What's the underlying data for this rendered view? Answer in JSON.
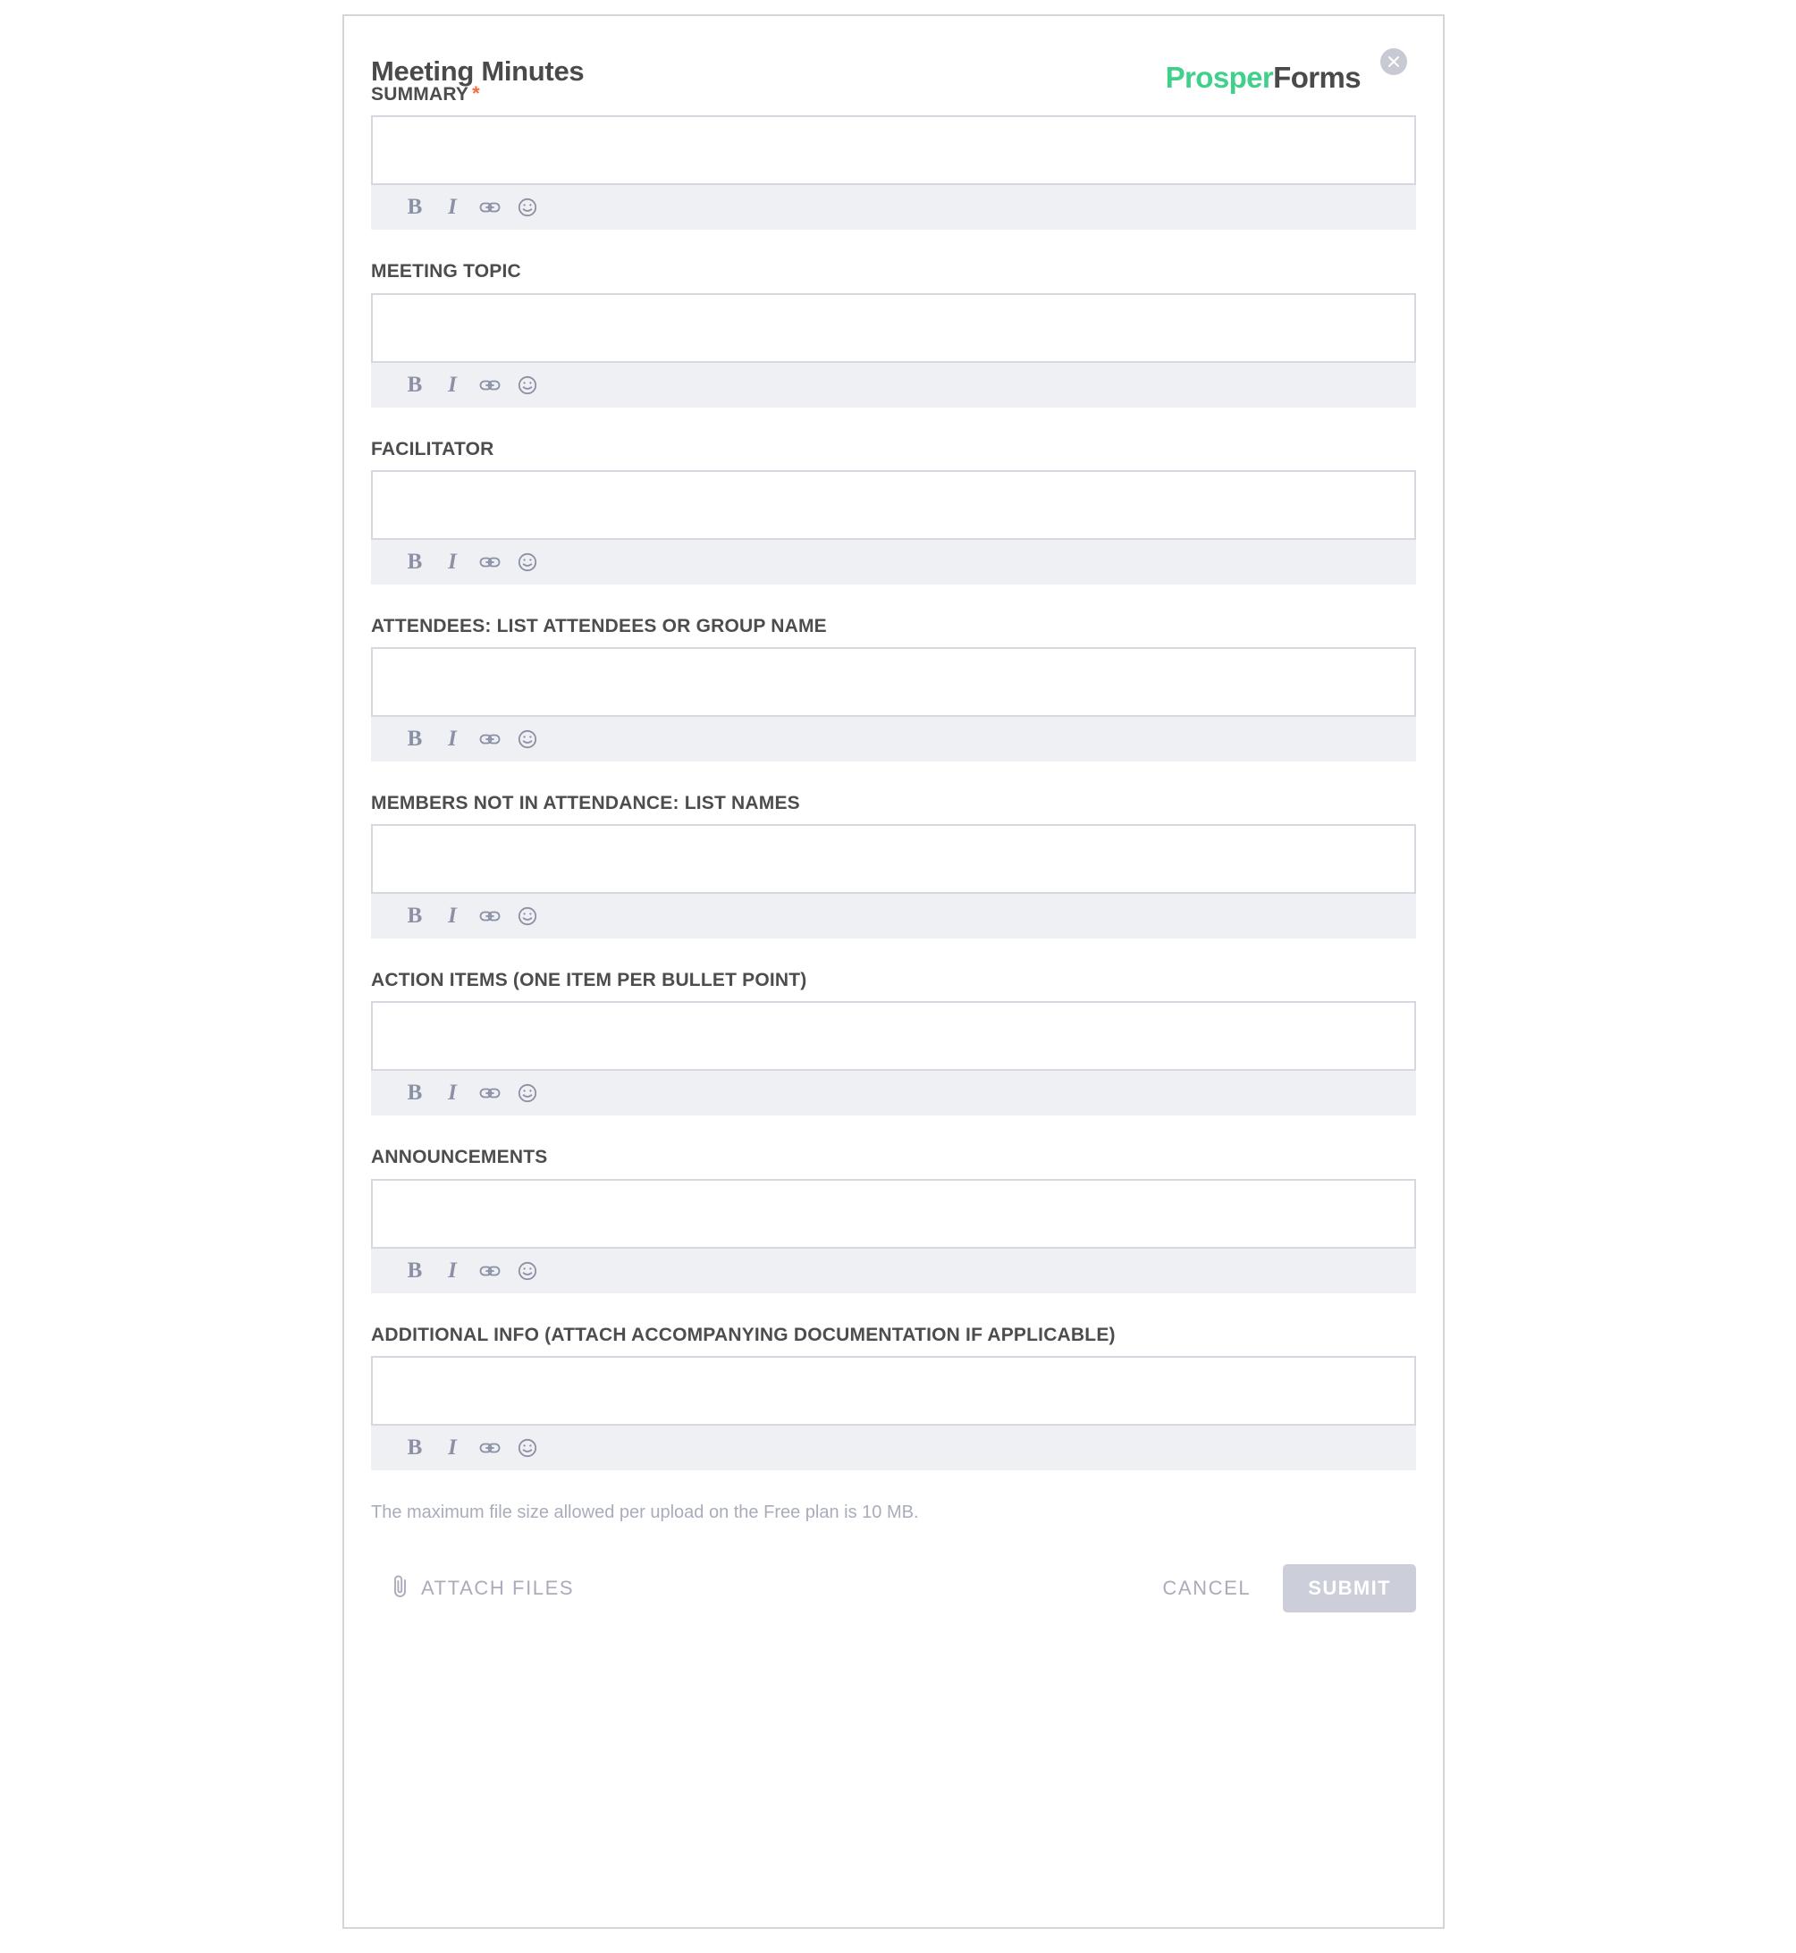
{
  "modal": {
    "title": "Meeting Minutes",
    "close_icon": "close-icon"
  },
  "brand": {
    "name_part1": "Prosper",
    "name_part2": "Forms",
    "color_primary": "#3fd18b",
    "color_secondary": "#4a4a4a"
  },
  "toolbar": {
    "bold_label": "B",
    "italic_label": "I",
    "link_icon": "link-icon",
    "emoji_icon": "emoji-icon"
  },
  "fields": [
    {
      "label": "SUMMARY",
      "required": true,
      "required_marker": "*",
      "value": "",
      "placeholder": ""
    },
    {
      "label": "MEETING TOPIC",
      "required": false,
      "value": "",
      "placeholder": ""
    },
    {
      "label": "FACILITATOR",
      "required": false,
      "value": "",
      "placeholder": ""
    },
    {
      "label": "ATTENDEES: LIST ATTENDEES OR GROUP NAME",
      "required": false,
      "value": "",
      "placeholder": ""
    },
    {
      "label": "MEMBERS NOT IN ATTENDANCE: LIST NAMES",
      "required": false,
      "value": "",
      "placeholder": ""
    },
    {
      "label": "ACTION ITEMS (ONE ITEM PER BULLET POINT)",
      "required": false,
      "value": "",
      "placeholder": ""
    },
    {
      "label": "ANNOUNCEMENTS",
      "required": false,
      "value": "",
      "placeholder": ""
    },
    {
      "label": "ADDITIONAL INFO (ATTACH ACCOMPANYING DOCUMENTATION IF APPLICABLE)",
      "required": false,
      "value": "",
      "placeholder": ""
    }
  ],
  "footer": {
    "filesize_note": "The maximum file size allowed per upload on the Free plan is 10 MB.",
    "attach_label": "ATTACH FILES",
    "attach_icon": "paperclip-icon",
    "cancel_label": "CANCEL",
    "submit_label": "SUBMIT",
    "submit_color": "#ccced9"
  }
}
